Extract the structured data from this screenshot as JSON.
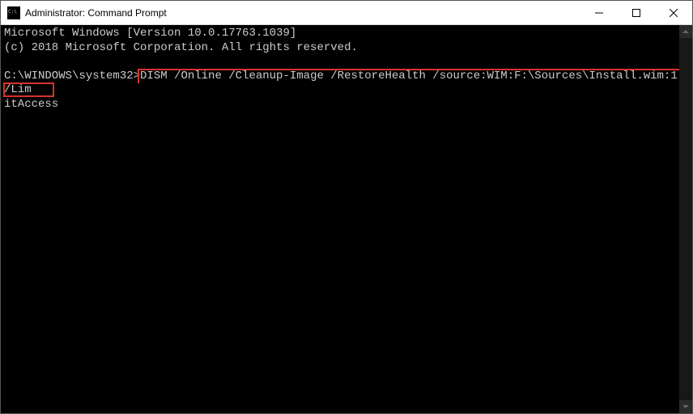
{
  "titlebar": {
    "title": "Administrator: Command Prompt"
  },
  "terminal": {
    "line1": "Microsoft Windows [Version 10.0.17763.1039]",
    "line2": "(c) 2018 Microsoft Corporation. All rights reserved.",
    "prompt": "C:\\WINDOWS\\system32>",
    "command_part1": "DISM /Online /Cleanup-Image /RestoreHealth /source:WIM:F:\\Sources\\Install.wim:1 /Lim",
    "command_part2": "itAccess",
    "full_command": "DISM /Online /Cleanup-Image /RestoreHealth /source:WIM:F:\\Sources\\Install.wim:1 /LimitAccess"
  },
  "highlight": {
    "color": "#d9322c"
  }
}
